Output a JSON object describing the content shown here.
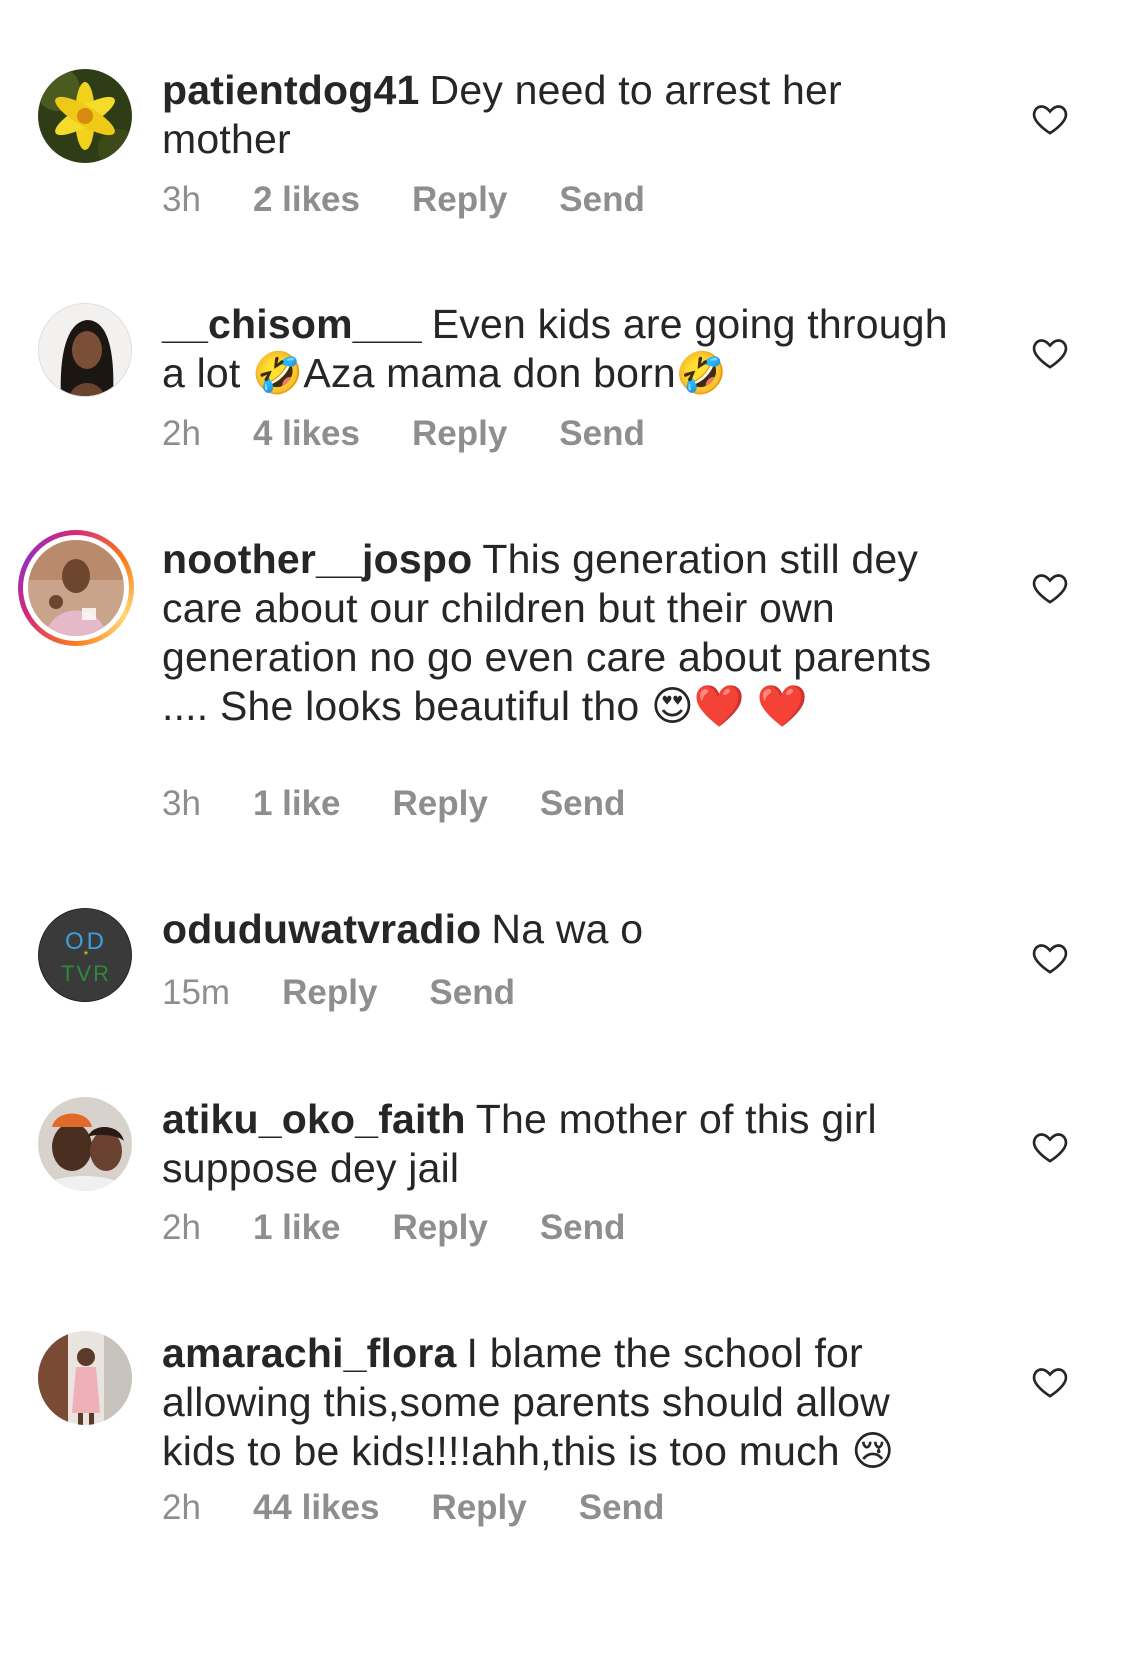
{
  "comments": [
    {
      "username": "patientdog41",
      "text": "Dey need to arrest her mother",
      "time": "3h",
      "likes": "2 likes",
      "reply": "Reply",
      "send": "Send",
      "avatar_icon": "yellow-lily-avatar"
    },
    {
      "username": "__chisom___",
      "text": "Even kids are going through a lot 🤣Aza mama don born🤣",
      "time": "2h",
      "likes": "4 likes",
      "reply": "Reply",
      "send": "Send",
      "avatar_icon": "woman-portrait-avatar"
    },
    {
      "username": "noother__jospo",
      "text": "This generation still dey care about our children but their own generation no go even care about parents .... She looks beautiful tho 😍❤️ ❤️",
      "time": "3h",
      "likes": "1 like",
      "reply": "Reply",
      "send": "Send",
      "avatar_icon": "man-photo-avatar-story-ring"
    },
    {
      "username": "oduduwatvradio",
      "text": "Na wa o",
      "time": "15m",
      "likes": "",
      "reply": "Reply",
      "send": "Send",
      "avatar_icon": "odtvr-logo-avatar",
      "avatar_text_top": "OD",
      "avatar_text_bottom": "TVR"
    },
    {
      "username": "atiku_oko_faith",
      "text": "The mother of this girl suppose dey jail",
      "time": "2h",
      "likes": "1 like",
      "reply": "Reply",
      "send": "Send",
      "avatar_icon": "couple-selfie-avatar"
    },
    {
      "username": "amarachi_flora",
      "text": "I blame the school for allowing this,some parents should allow kids to be kids!!!!ahh,this is too much 😢",
      "time": "2h",
      "likes": "44 likes",
      "reply": "Reply",
      "send": "Send",
      "avatar_icon": "woman-standing-avatar"
    }
  ],
  "colors": {
    "text": "#262626",
    "meta": "#8e8e8e",
    "heart_outline": "#262626"
  }
}
